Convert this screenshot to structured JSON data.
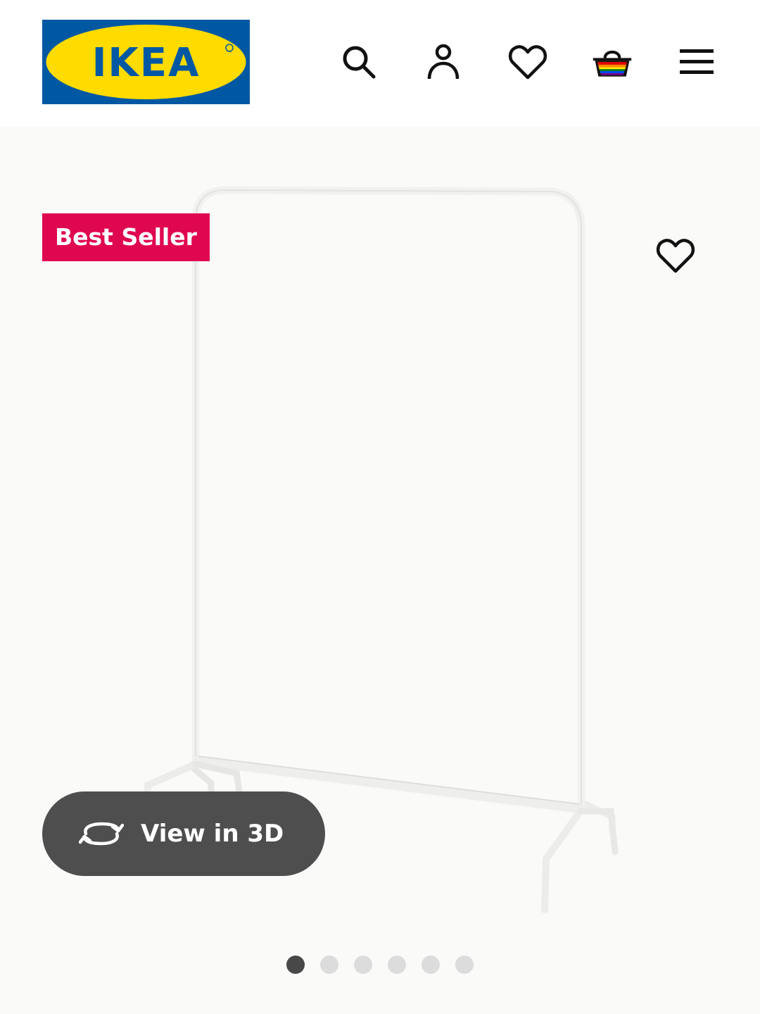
{
  "header": {
    "logo_text": "IKEA",
    "icons": [
      "search-icon",
      "account-icon",
      "heart-icon",
      "basket-icon",
      "hamburger-menu-icon"
    ]
  },
  "product": {
    "badge": "Best Seller",
    "view_3d_label": "View in 3D",
    "image_count": 6,
    "active_image_index": 0
  },
  "colors": {
    "ikea_blue": "#0058a3",
    "ikea_yellow": "#ffdb00",
    "badge_red": "#e00751",
    "view3d_bg": "#4e4e4e"
  }
}
